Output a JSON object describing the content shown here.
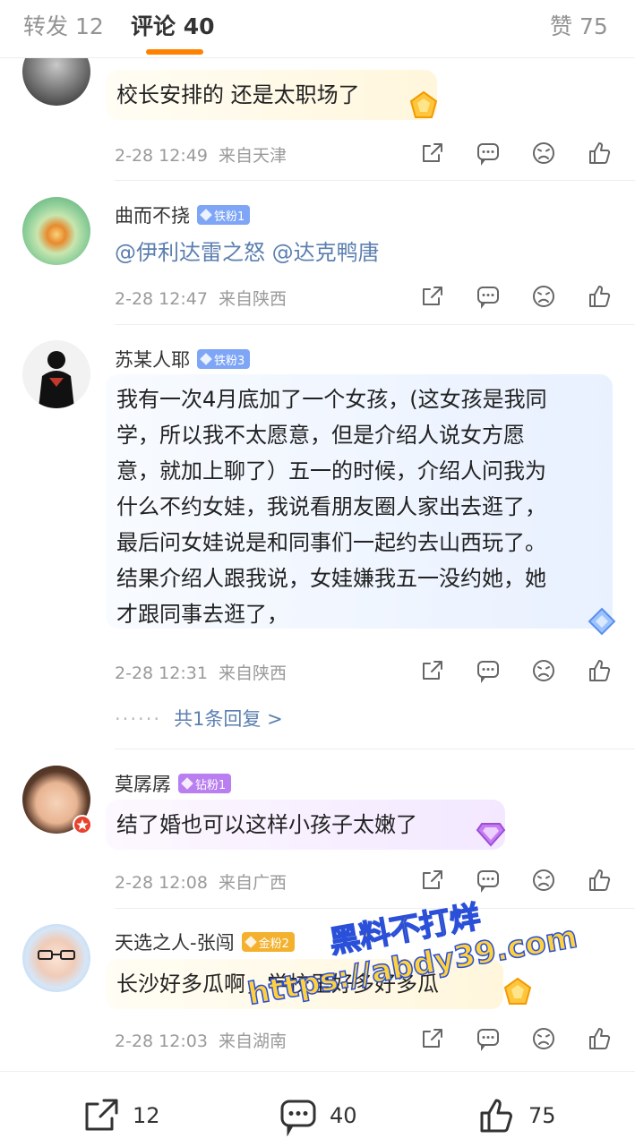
{
  "tabs": {
    "repost": "转发 12",
    "comments": "评论 40",
    "likes": "赞 75"
  },
  "comments": [
    {
      "username": "",
      "text": "校长安排的 还是太职场了",
      "time": "2-28 12:49",
      "location": "来自天津"
    },
    {
      "username": "曲而不挠",
      "badge": "铁粉1",
      "mention1": "@伊利达雷之怒",
      "mention2": "@达克鸭唐",
      "time": "2-28 12:47",
      "location": "来自陕西"
    },
    {
      "username": "苏某人耶",
      "badge": "铁粉3",
      "lines": [
        "我有一次4月底加了一个女孩，(这女孩是我同",
        "学，所以我不太愿意，但是介绍人说女方愿",
        "意，就加上聊了）五一的时候，介绍人问我为",
        "什么不约女娃，我说看朋友圈人家出去逛了，",
        "最后问女娃说是和同事们一起约去山西玩了。",
        "结果介绍人跟我说，女娃嫌我五一没约她，她",
        "才跟同事去逛了，"
      ],
      "time": "2-28 12:31",
      "location": "来自陕西",
      "replies": "共1条回复 >"
    },
    {
      "username": "莫孱孱",
      "badge": "钻粉1",
      "text": "结了婚也可以这样小孩子太嫩了",
      "time": "2-28 12:08",
      "location": "来自广西"
    },
    {
      "username": "天选之人-张闯",
      "badge": "金粉2",
      "text": "长沙好多瓜啊，学校里好多好多瓜",
      "time": "2-28 12:03",
      "location": "来自湖南"
    }
  ],
  "watermark": {
    "line1": "黑料不打烊",
    "line2": "https://abdy39.com"
  },
  "bottom": {
    "repost_count": "12",
    "comment_count": "40",
    "like_count": "75"
  },
  "icons": [
    "share-icon",
    "comment-icon",
    "dislike-icon",
    "like-icon"
  ],
  "colors": {
    "accent": "#ff8200",
    "link": "#5b7fb0",
    "meta": "#9a9a9a"
  }
}
